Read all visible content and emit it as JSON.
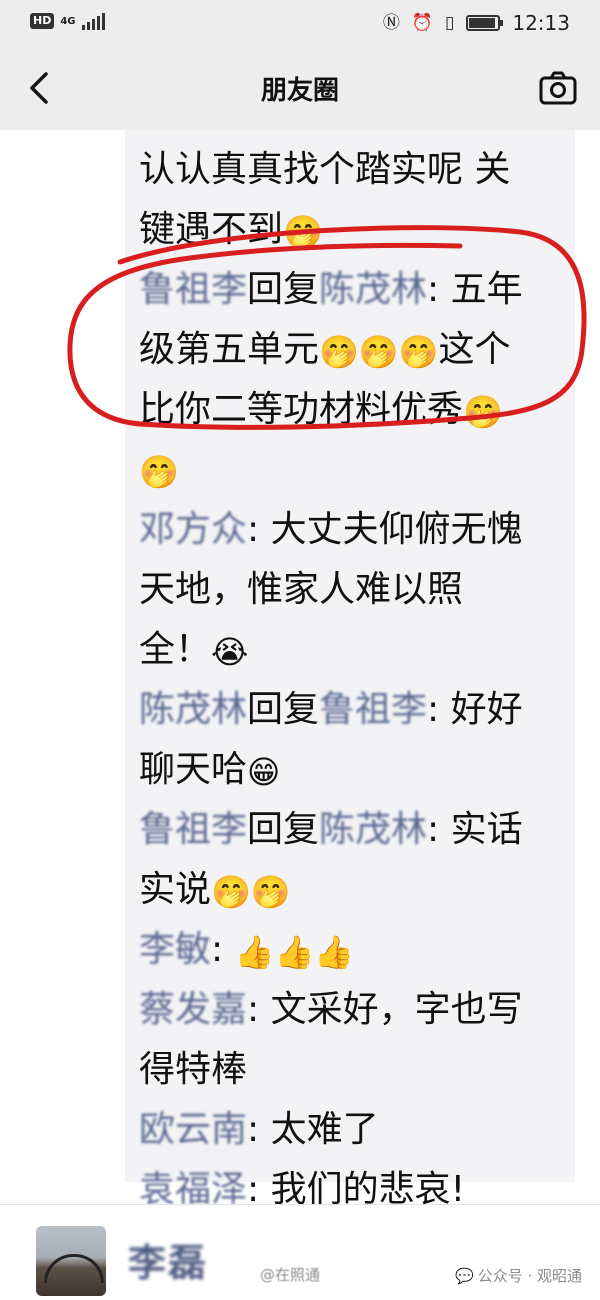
{
  "status_bar": {
    "badge": "HD",
    "network": "4G",
    "time": "12:13",
    "icons": [
      "nfc-icon",
      "alarm-icon",
      "vibrate-icon",
      "battery-icon"
    ],
    "battery_level": 0.9
  },
  "nav": {
    "title": "朋友圈",
    "back_icon": "chevron-left-icon",
    "camera_icon": "camera-icon"
  },
  "comments": {
    "items": [
      {
        "text": "认认真真找个踏实呢  关"
      },
      {
        "text": "键遇不到",
        "emoji": "🤭"
      },
      {
        "name": "鲁祖李",
        "mid": "回复",
        "name2": "陈茂林",
        "text": ": 五年"
      },
      {
        "text": "级第五单元",
        "emoji": "🤭🤭🤭",
        "text2": "这个"
      },
      {
        "text": "比你二等功材料优秀",
        "emoji": "🤭"
      },
      {
        "emoji": "🤭"
      },
      {
        "name": "邓方众",
        "text": ": 大丈夫仰俯无愧"
      },
      {
        "text": "天地，惟家人难以照"
      },
      {
        "text": "全！",
        "emoji": "😭"
      },
      {
        "name": "陈茂林",
        "mid": "回复",
        "name2": "鲁祖李",
        "text": ": 好好"
      },
      {
        "text": "聊天哈",
        "emoji": "😁"
      },
      {
        "name": "鲁祖李",
        "mid": "回复",
        "name2": "陈茂林",
        "text": ": 实话"
      },
      {
        "text": "实说",
        "emoji": "🤭🤭"
      },
      {
        "name": "李敏",
        "text": ": ",
        "emoji": "👍👍👍"
      },
      {
        "name": "蔡发嘉",
        "text": ": 文采好，字也写"
      },
      {
        "text": "得特棒"
      },
      {
        "name": "欧云南",
        "text": ": 太难了"
      },
      {
        "name": "袁福泽",
        "text": ": 我们的悲哀!"
      }
    ]
  },
  "annotation_color": "#d81e1e",
  "bottom": {
    "user_name": "李磊",
    "watermark_left": "@在照通",
    "source_icon": "wechat-icon",
    "source_text": "公众号 · 观昭通"
  }
}
